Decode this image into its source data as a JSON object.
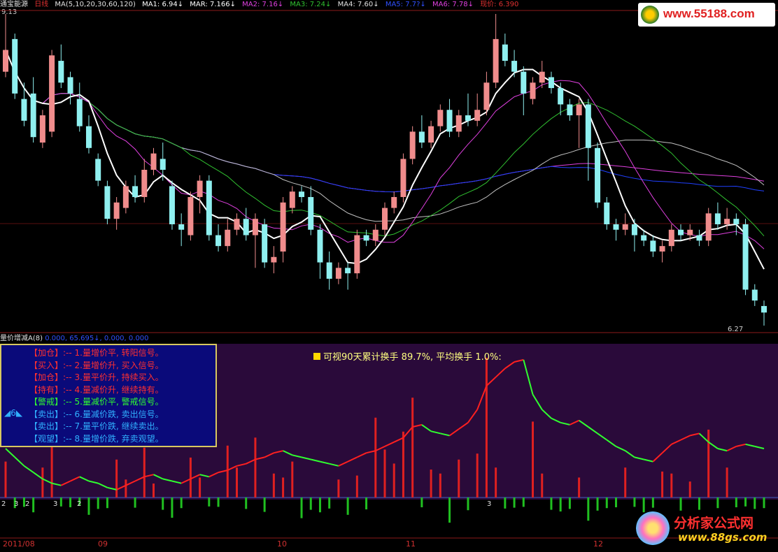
{
  "header": {
    "stock_name": "通宝能源",
    "period": "日线",
    "ma_params": "MA(5,10,20,30,60,120)",
    "ma1": "MA1: 6.94↓",
    "mar": "MAR: 7.166↓",
    "ma2": "MA2: 7.16↓",
    "ma3": "MA3: 7.24↓",
    "ma4": "MA4: 7.60↓",
    "ma5": "MA5: 7.7?↓",
    "ma6": "MA6: 7.78↓",
    "price": "现价: 6.390",
    "high_label": "9.13",
    "low_label": "6.27"
  },
  "indicator_header": {
    "name": "量价增减A(8)",
    "values": "0.000, 65.695↓, 0.000, 0.000"
  },
  "turnover_note": "可视90天累计换手  89.7%,   平均换手  1.0%:",
  "legend": {
    "page_label": "6",
    "items": [
      {
        "tag": "【加仓】",
        "text": ":-- 1.量增价平, 转阳信号。",
        "color": "#ff3030"
      },
      {
        "tag": "【买入】",
        "text": ":-- 2.量增价升, 买入信号。",
        "color": "#ff3030"
      },
      {
        "tag": "【加仓】",
        "text": ":-- 3.量平价升, 持续买入。",
        "color": "#ff3030"
      },
      {
        "tag": "【持有】",
        "text": ":-- 4.量减价升, 继续持有。",
        "color": "#ff3030"
      },
      {
        "tag": "【警戒】",
        "text": ":-- 5.量减价平, 警戒信号。",
        "color": "#30ff30"
      },
      {
        "tag": "【卖出】",
        "text": ":-- 6.量减价跌, 卖出信号。",
        "color": "#30b0ff"
      },
      {
        "tag": "【卖出】",
        "text": ":-- 7.量平价跌, 继续卖出。",
        "color": "#30b0ff"
      },
      {
        "tag": "【观望】",
        "text": ":-- 8.量增价跌, 弃卖观望。",
        "color": "#30b0ff"
      }
    ]
  },
  "dates": [
    "2011/08",
    "09",
    "10",
    "11",
    "12"
  ],
  "signal_digits": [
    "2",
    "3",
    "2",
    "3",
    "2",
    "3"
  ],
  "logo_top": "www.55188.com",
  "logo_bottom": {
    "title": "分析家公式网",
    "url": "www.88gs.com"
  },
  "colors": {
    "up": "#f08c8c",
    "down": "#8ff0f0",
    "ma5": "#ffffff",
    "ma10": "#e040e0",
    "ma20": "#30c030",
    "ma30": "#c0c0c0",
    "ma60": "#2040ff",
    "ma120": "#e040e0",
    "vol_up": "#e02020",
    "vol_down": "#20c020"
  },
  "chart_data": {
    "type": "candlestick",
    "x": [
      "2011/08",
      "09",
      "10",
      "11",
      "12"
    ],
    "ylim": [
      6.27,
      9.13
    ],
    "candles": [
      {
        "o": 8.6,
        "c": 8.8,
        "h": 9.13,
        "l": 8.55
      },
      {
        "o": 8.9,
        "c": 8.4,
        "h": 8.95,
        "l": 8.35
      },
      {
        "o": 8.35,
        "c": 8.15,
        "h": 8.5,
        "l": 8.1
      },
      {
        "o": 8.4,
        "c": 8.0,
        "h": 8.55,
        "l": 7.95
      },
      {
        "o": 7.95,
        "c": 8.2,
        "h": 8.25,
        "l": 7.9
      },
      {
        "o": 8.05,
        "c": 8.75,
        "h": 8.8,
        "l": 8.0
      },
      {
        "o": 8.7,
        "c": 8.5,
        "h": 8.85,
        "l": 8.45
      },
      {
        "o": 8.55,
        "c": 8.4,
        "h": 8.6,
        "l": 8.3
      },
      {
        "o": 8.35,
        "c": 8.1,
        "h": 8.5,
        "l": 8.05
      },
      {
        "o": 8.1,
        "c": 7.9,
        "h": 8.2,
        "l": 7.85
      },
      {
        "o": 7.8,
        "c": 7.6,
        "h": 7.85,
        "l": 7.55
      },
      {
        "o": 7.55,
        "c": 7.25,
        "h": 7.6,
        "l": 7.2
      },
      {
        "o": 7.25,
        "c": 7.4,
        "h": 7.45,
        "l": 7.15
      },
      {
        "o": 7.35,
        "c": 7.55,
        "h": 7.6,
        "l": 7.3
      },
      {
        "o": 7.55,
        "c": 7.45,
        "h": 7.65,
        "l": 7.4
      },
      {
        "o": 7.45,
        "c": 7.7,
        "h": 7.8,
        "l": 7.4
      },
      {
        "o": 7.7,
        "c": 7.85,
        "h": 7.9,
        "l": 7.65
      },
      {
        "o": 7.8,
        "c": 7.7,
        "h": 7.95,
        "l": 7.6
      },
      {
        "o": 7.55,
        "c": 7.2,
        "h": 7.6,
        "l": 7.15
      },
      {
        "o": 7.2,
        "c": 7.15,
        "h": 7.3,
        "l": 7.0
      },
      {
        "o": 7.1,
        "c": 7.45,
        "h": 7.5,
        "l": 7.05
      },
      {
        "o": 7.45,
        "c": 7.6,
        "h": 7.65,
        "l": 7.3
      },
      {
        "o": 7.6,
        "c": 7.1,
        "h": 7.65,
        "l": 7.05
      },
      {
        "o": 7.1,
        "c": 7.0,
        "h": 7.2,
        "l": 6.95
      },
      {
        "o": 7.0,
        "c": 7.15,
        "h": 7.25,
        "l": 6.95
      },
      {
        "o": 7.15,
        "c": 7.25,
        "h": 7.3,
        "l": 7.1
      },
      {
        "o": 7.25,
        "c": 7.1,
        "h": 7.35,
        "l": 7.05
      },
      {
        "o": 7.1,
        "c": 7.25,
        "h": 7.3,
        "l": 6.8
      },
      {
        "o": 7.2,
        "c": 6.85,
        "h": 7.25,
        "l": 6.8
      },
      {
        "o": 6.85,
        "c": 6.9,
        "h": 7.0,
        "l": 6.75
      },
      {
        "o": 6.95,
        "c": 7.4,
        "h": 7.45,
        "l": 6.85
      },
      {
        "o": 7.35,
        "c": 7.5,
        "h": 7.55,
        "l": 7.3
      },
      {
        "o": 7.5,
        "c": 7.45,
        "h": 7.55,
        "l": 7.4
      },
      {
        "o": 7.45,
        "c": 7.15,
        "h": 7.55,
        "l": 7.1
      },
      {
        "o": 7.15,
        "c": 6.85,
        "h": 7.2,
        "l": 6.7
      },
      {
        "o": 6.85,
        "c": 6.7,
        "h": 6.95,
        "l": 6.6
      },
      {
        "o": 6.7,
        "c": 6.8,
        "h": 6.85,
        "l": 6.65
      },
      {
        "o": 6.8,
        "c": 6.75,
        "h": 6.85,
        "l": 6.6
      },
      {
        "o": 6.75,
        "c": 7.1,
        "h": 7.15,
        "l": 6.7
      },
      {
        "o": 7.1,
        "c": 7.05,
        "h": 7.15,
        "l": 7.0
      },
      {
        "o": 7.05,
        "c": 7.15,
        "h": 7.2,
        "l": 7.0
      },
      {
        "o": 7.15,
        "c": 7.35,
        "h": 7.4,
        "l": 7.1
      },
      {
        "o": 7.35,
        "c": 7.45,
        "h": 7.5,
        "l": 7.3
      },
      {
        "o": 7.45,
        "c": 7.8,
        "h": 7.85,
        "l": 7.4
      },
      {
        "o": 7.8,
        "c": 8.05,
        "h": 8.1,
        "l": 7.75
      },
      {
        "o": 8.05,
        "c": 7.95,
        "h": 8.2,
        "l": 7.9
      },
      {
        "o": 7.95,
        "c": 8.1,
        "h": 8.15,
        "l": 7.9
      },
      {
        "o": 8.1,
        "c": 8.25,
        "h": 8.3,
        "l": 8.05
      },
      {
        "o": 8.25,
        "c": 8.05,
        "h": 8.35,
        "l": 8.0
      },
      {
        "o": 8.05,
        "c": 8.2,
        "h": 8.25,
        "l": 8.0
      },
      {
        "o": 8.2,
        "c": 8.15,
        "h": 8.4,
        "l": 8.1
      },
      {
        "o": 8.15,
        "c": 8.25,
        "h": 8.4,
        "l": 8.1
      },
      {
        "o": 8.25,
        "c": 8.5,
        "h": 8.6,
        "l": 8.2
      },
      {
        "o": 8.5,
        "c": 8.9,
        "h": 9.13,
        "l": 8.45
      },
      {
        "o": 8.85,
        "c": 8.7,
        "h": 8.95,
        "l": 8.65
      },
      {
        "o": 8.7,
        "c": 8.6,
        "h": 8.8,
        "l": 8.55
      },
      {
        "o": 8.6,
        "c": 8.4,
        "h": 8.65,
        "l": 8.2
      },
      {
        "o": 8.35,
        "c": 8.5,
        "h": 8.55,
        "l": 8.3
      },
      {
        "o": 8.5,
        "c": 8.6,
        "h": 8.7,
        "l": 8.45
      },
      {
        "o": 8.55,
        "c": 8.45,
        "h": 8.6,
        "l": 8.4
      },
      {
        "o": 8.45,
        "c": 8.3,
        "h": 8.5,
        "l": 8.2
      },
      {
        "o": 8.3,
        "c": 8.2,
        "h": 8.35,
        "l": 8.15
      },
      {
        "o": 8.2,
        "c": 8.3,
        "h": 8.35,
        "l": 7.9
      },
      {
        "o": 8.3,
        "c": 7.9,
        "h": 8.35,
        "l": 7.6
      },
      {
        "o": 7.9,
        "c": 7.4,
        "h": 7.95,
        "l": 7.35
      },
      {
        "o": 7.4,
        "c": 7.2,
        "h": 7.45,
        "l": 7.15
      },
      {
        "o": 7.2,
        "c": 7.15,
        "h": 7.25,
        "l": 7.05
      },
      {
        "o": 7.15,
        "c": 7.2,
        "h": 7.3,
        "l": 7.1
      },
      {
        "o": 7.2,
        "c": 7.1,
        "h": 7.25,
        "l": 6.95
      },
      {
        "o": 7.1,
        "c": 7.05,
        "h": 7.15,
        "l": 7.0
      },
      {
        "o": 7.05,
        "c": 6.95,
        "h": 7.1,
        "l": 6.9
      },
      {
        "o": 6.95,
        "c": 7.0,
        "h": 7.05,
        "l": 6.85
      },
      {
        "o": 7.0,
        "c": 7.15,
        "h": 7.2,
        "l": 6.95
      },
      {
        "o": 7.15,
        "c": 7.1,
        "h": 7.2,
        "l": 7.05
      },
      {
        "o": 7.1,
        "c": 7.15,
        "h": 7.2,
        "l": 7.05
      },
      {
        "o": 7.1,
        "c": 7.05,
        "h": 7.15,
        "l": 7.0
      },
      {
        "o": 7.05,
        "c": 7.3,
        "h": 7.35,
        "l": 7.0
      },
      {
        "o": 7.3,
        "c": 7.2,
        "h": 7.4,
        "l": 7.15
      },
      {
        "o": 7.2,
        "c": 7.25,
        "h": 7.35,
        "l": 7.15
      },
      {
        "o": 7.25,
        "c": 7.2,
        "h": 7.3,
        "l": 7.1
      },
      {
        "o": 7.2,
        "c": 6.6,
        "h": 7.25,
        "l": 6.55
      },
      {
        "o": 6.6,
        "c": 6.5,
        "h": 6.65,
        "l": 6.45
      },
      {
        "o": 6.45,
        "c": 6.39,
        "h": 6.5,
        "l": 6.27
      }
    ],
    "volume": [
      18,
      12,
      9,
      22,
      15,
      30,
      8,
      10,
      6,
      28,
      14,
      12,
      19,
      9,
      11,
      25,
      7,
      16,
      35,
      12,
      20,
      10,
      8,
      9,
      26,
      15,
      14,
      30,
      21,
      12,
      10,
      18,
      36,
      16,
      22,
      13,
      9,
      28,
      11,
      15,
      40,
      24,
      17,
      33,
      50,
      10,
      14,
      12,
      56,
      19,
      17,
      22,
      70,
      15,
      13,
      11,
      9,
      38,
      12,
      16,
      20,
      14,
      10,
      42,
      18,
      12,
      10,
      15,
      9,
      22,
      11,
      13,
      12,
      18,
      8,
      16,
      34,
      12,
      15,
      10,
      8,
      14,
      12
    ],
    "turnover_line": [
      60,
      52,
      44,
      38,
      32,
      28,
      26,
      30,
      34,
      30,
      28,
      24,
      22,
      26,
      30,
      34,
      36,
      32,
      30,
      28,
      32,
      36,
      34,
      38,
      40,
      44,
      46,
      50,
      52,
      56,
      58,
      54,
      52,
      50,
      48,
      46,
      44,
      48,
      52,
      56,
      58,
      62,
      66,
      70,
      80,
      82,
      76,
      74,
      72,
      78,
      84,
      96,
      118,
      126,
      134,
      140,
      142,
      110,
      96,
      88,
      84,
      82,
      86,
      80,
      74,
      68,
      62,
      58,
      52,
      50,
      48,
      56,
      64,
      68,
      72,
      74,
      66,
      60,
      58,
      62,
      64,
      62,
      60
    ]
  }
}
